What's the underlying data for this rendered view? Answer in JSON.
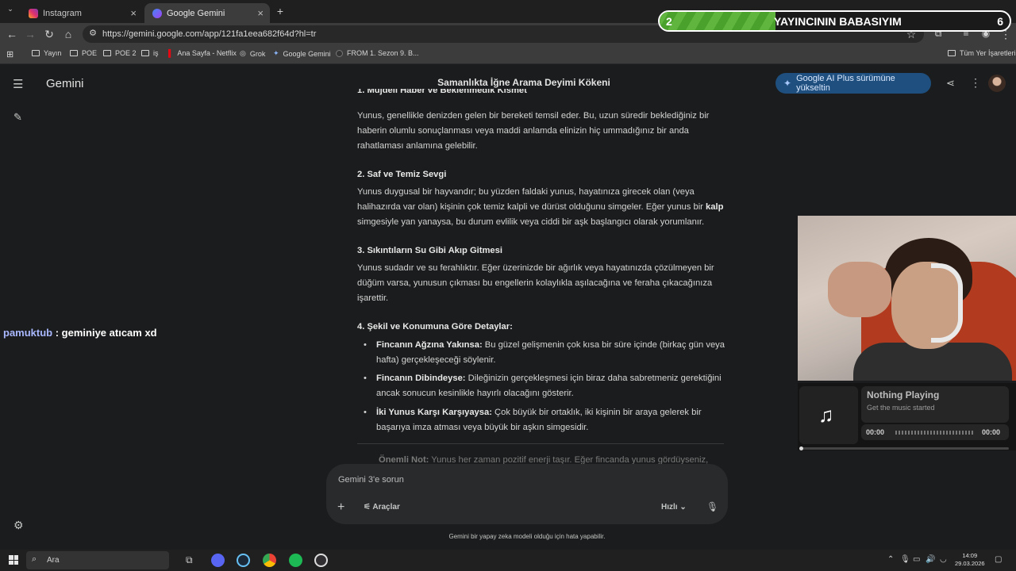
{
  "browser": {
    "tabs": [
      {
        "label": "Instagram",
        "active": false
      },
      {
        "label": "Google Gemini",
        "active": true
      }
    ],
    "url": "https://gemini.google.com/app/121fa1eea682f64d?hl=tr",
    "bookmarks": [
      "Yayın",
      "POE",
      "POE 2",
      "iş",
      "Ana Sayfa - Netflix",
      "Grok",
      "Google Gemini",
      "FROM 1. Sezon 9. B..."
    ],
    "all_bookmarks": "Tüm Yer İşaretleri"
  },
  "banner": {
    "left_value": "2",
    "text": "YAYINCININ BABASIYIM",
    "right_value": "6",
    "progress_fraction": 0.33
  },
  "app": {
    "brand": "Gemini",
    "conversation_title": "Samanlıkta İğne Arama Deyimi Kökeni",
    "upgrade_label": "Google AI Plus sürümüne yükseltin"
  },
  "content": {
    "cut_heading": "1. Müjdeli Haber ve Beklenmedik Kısmet",
    "p1": "Yunus, genellikle denizden gelen bir bereketi temsil eder. Bu, uzun süredir beklediğiniz bir haberin olumlu sonuçlanması veya maddi anlamda elinizin hiç ummadığınız bir anda rahatlaması anlamına gelebilir.",
    "h2": "2. Saf ve Temiz Sevgi",
    "p2_a": "Yunus duygusal bir hayvandır; bu yüzden faldaki yunus, hayatınıza girecek olan (veya halihazırda var olan) kişinin çok temiz kalpli ve dürüst olduğunu simgeler. Eğer yunus bir ",
    "p2_b": "kalp",
    "p2_c": " simgesiyle yan yanaysa, bu durum evlilik veya ciddi bir aşk başlangıcı olarak yorumlanır.",
    "h3": "3. Sıkıntıların Su Gibi Akıp Gitmesi",
    "p3": "Yunus sudadır ve su ferahlıktır. Eğer üzerinizde bir ağırlık veya hayatınızda çözülmeyen bir düğüm varsa, yunusun çıkması bu engellerin kolaylıkla aşılacağına ve feraha çıkacağınıza işarettir.",
    "h4": "4. Şekil ve Konumuna Göre Detaylar:",
    "bullets": [
      {
        "title": "Fincanın Ağzına Yakınsa:",
        "text": " Bu güzel gelişmenin çok kısa bir süre içinde (birkaç gün veya hafta) gerçekleşeceği söylenir."
      },
      {
        "title": "Fincanın Dibindeyse:",
        "text": " Dileğinizin gerçekleşmesi için biraz daha sabretmeniz gerektiğini ancak sonucun kesinlikle hayırlı olacağını gösterir."
      },
      {
        "title": "İki Yunus Karşı Karşıyaysa:",
        "text": " Çok büyük bir ortaklık, iki kişinin bir araya gelerek bir başarıya imza atması veya büyük bir aşkın simgesidir."
      }
    ],
    "note_title": "Önemli Not:",
    "note_text": " Yunus her zaman pozitif enerji taşır. Eğer fincanda yunus gördüyseniz,"
  },
  "input": {
    "placeholder": "Gemini 3'e sorun",
    "tools_label": "Araçlar",
    "mode_label": "Hızlı",
    "disclaimer": "Gemini bir yapay zeka modeli olduğu için hata yapabilir."
  },
  "chat": {
    "user": "pamuktub",
    "message": " : geminiye atıcam xd"
  },
  "music": {
    "title": "Nothing Playing",
    "subtitle": "Get the music started",
    "time_current": "00:00",
    "time_total": "00:00"
  },
  "taskbar": {
    "search_label": "Ara",
    "time": "14:09",
    "date": "29.03.2026"
  },
  "colors": {
    "background": "#1b1c1d",
    "upgrade_button": "#1e4f7e",
    "banner_fill": "#5fb53d",
    "chat_user": "#a9b8ff"
  }
}
